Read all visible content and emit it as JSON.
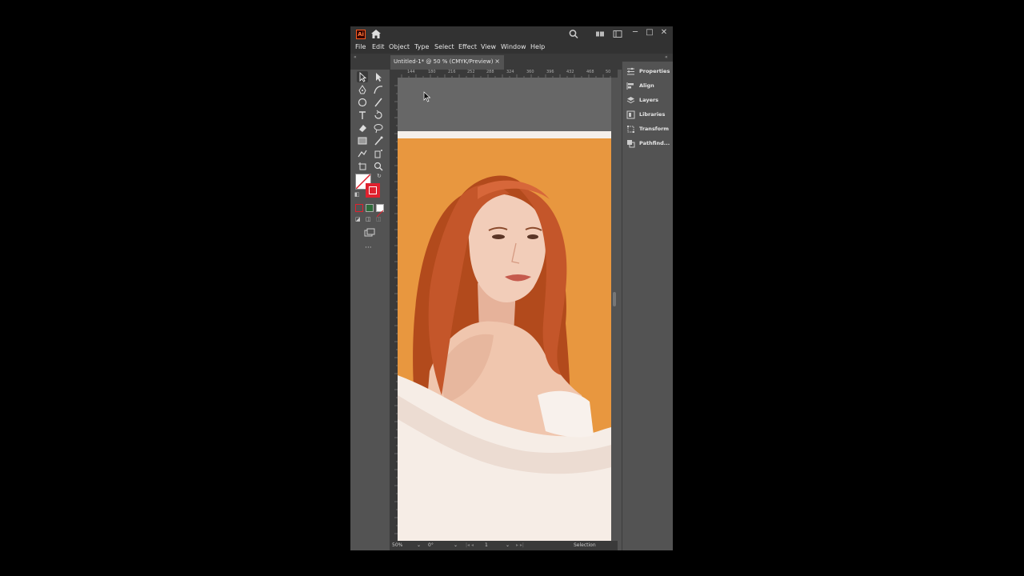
{
  "app": {
    "logo_text": "Ai",
    "brand_color": "#ff5a1f"
  },
  "menu": [
    {
      "label": "File"
    },
    {
      "label": "Edit"
    },
    {
      "label": "Object"
    },
    {
      "label": "Type"
    },
    {
      "label": "Select"
    },
    {
      "label": "Effect"
    },
    {
      "label": "View"
    },
    {
      "label": "Window"
    },
    {
      "label": "Help"
    }
  ],
  "document_tab": {
    "label": "Untitled-1* @ 50 % (CMYK/Preview)",
    "close": "×"
  },
  "ruler": {
    "top_ticks": [
      "144",
      "180",
      "216",
      "252",
      "288",
      "324",
      "360",
      "396",
      "432",
      "468",
      "50"
    ]
  },
  "right_panel": [
    {
      "label": "Properties",
      "icon": "properties-icon"
    },
    {
      "label": "Align",
      "icon": "align-icon"
    },
    {
      "label": "Layers",
      "icon": "layers-icon"
    },
    {
      "label": "Libraries",
      "icon": "libraries-icon"
    },
    {
      "label": "Transform",
      "icon": "transform-icon"
    },
    {
      "label": "Pathfind...",
      "icon": "pathfinder-icon"
    }
  ],
  "status": {
    "zoom": "50%",
    "rotation": "0°",
    "artboard": "1",
    "tool": "Selection"
  },
  "toolbar": {
    "more": "···"
  },
  "colors": {
    "artboard_bg": "#e8973f",
    "hair": "#b8501e",
    "fill_stroke": "#e0212e"
  }
}
